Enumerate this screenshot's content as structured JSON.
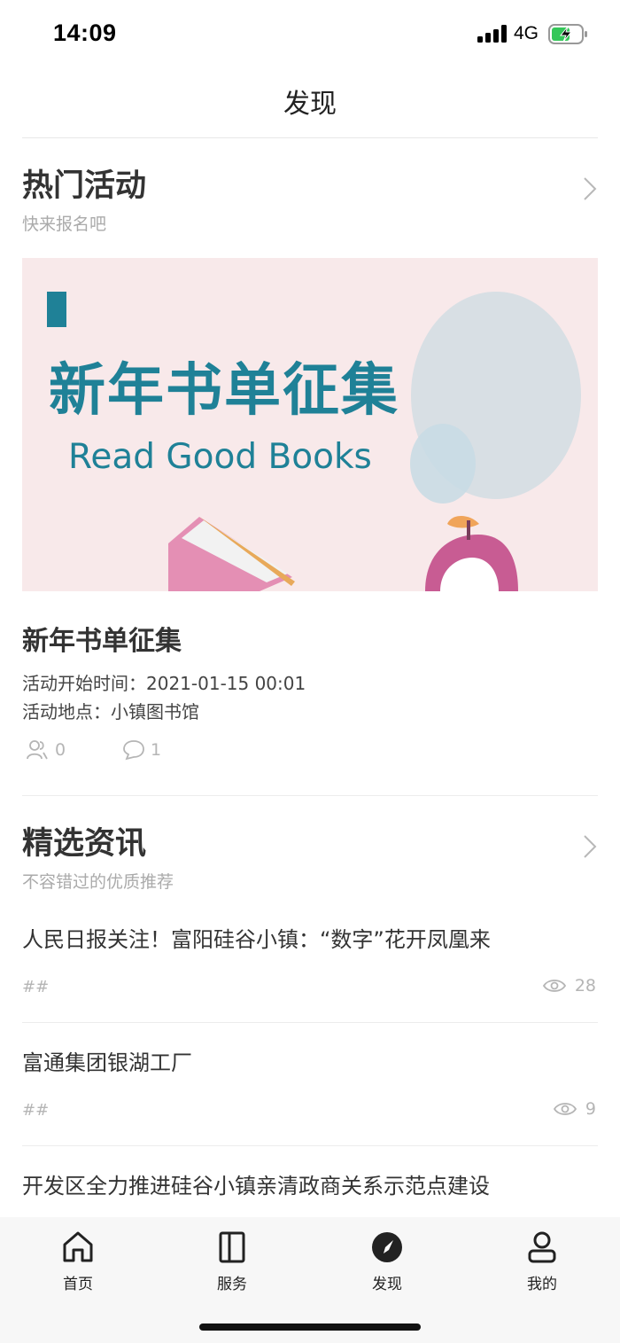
{
  "status_bar": {
    "time": "14:09",
    "network": "4G"
  },
  "nav": {
    "title": "发现"
  },
  "hot_activities": {
    "title": "热门活动",
    "subtitle": "快来报名吧",
    "banner": {
      "headline": "新年书单征集",
      "tagline": "Read Good Books"
    },
    "event": {
      "title": "新年书单征集",
      "start_time": "活动开始时间：2021-01-15 00:01",
      "location": "活动地点：小镇图书馆",
      "participants": "0",
      "comments": "1"
    }
  },
  "news": {
    "title": "精选资讯",
    "subtitle": "不容错过的优质推荐",
    "items": [
      {
        "title": "人民日报关注！富阳硅谷小镇：“数字”花开凤凰来",
        "tag": "##",
        "views": "28"
      },
      {
        "title": "富通集团银湖工厂",
        "tag": "##",
        "views": "9"
      },
      {
        "title": "开发区全力推进硅谷小镇亲清政商关系示范点建设"
      }
    ]
  },
  "tabbar": {
    "tabs": [
      {
        "label": "首页",
        "icon": "home-icon"
      },
      {
        "label": "服务",
        "icon": "book-icon"
      },
      {
        "label": "发现",
        "icon": "compass-icon",
        "active": true
      },
      {
        "label": "我的",
        "icon": "person-icon"
      }
    ]
  },
  "colors": {
    "banner_bg": "#f8e9ea",
    "banner_text": "#1f8197",
    "tab_active": "#222222"
  }
}
